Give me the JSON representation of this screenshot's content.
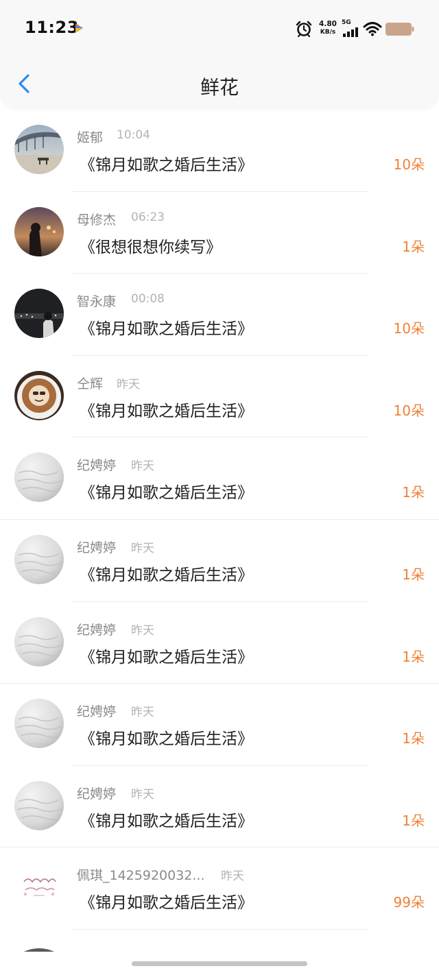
{
  "status_bar": {
    "time": "11:23",
    "net_speed_value": "4.80",
    "net_speed_unit": "KB/s",
    "network": "5G",
    "icons": [
      "app-badge-icon",
      "alarm-icon",
      "signal-icon",
      "wifi-icon",
      "battery-icon"
    ]
  },
  "nav": {
    "title": "鲜花",
    "back_icon": "chevron-left-icon"
  },
  "colors": {
    "accent_blue": "#2b8bf5",
    "count_orange": "#f08035",
    "muted_text": "#8a8a8a",
    "time_text": "#b3b3b3"
  },
  "items": [
    {
      "user": "姬郁",
      "time": "10:04",
      "book": "《锦月如歌之婚后生活》",
      "count": "10朵"
    },
    {
      "user": "母修杰",
      "time": "06:23",
      "book": "《很想很想你续写》",
      "count": "1朵"
    },
    {
      "user": "智永康",
      "time": "00:08",
      "book": "《锦月如歌之婚后生活》",
      "count": "10朵"
    },
    {
      "user": "仝辉",
      "time": "昨天",
      "book": "《锦月如歌之婚后生活》",
      "count": "10朵"
    },
    {
      "user": "纪娉婷",
      "time": "昨天",
      "book": "《锦月如歌之婚后生活》",
      "count": "1朵"
    },
    {
      "user": "纪娉婷",
      "time": "昨天",
      "book": "《锦月如歌之婚后生活》",
      "count": "1朵"
    },
    {
      "user": "纪娉婷",
      "time": "昨天",
      "book": "《锦月如歌之婚后生活》",
      "count": "1朵"
    },
    {
      "user": "纪娉婷",
      "time": "昨天",
      "book": "《锦月如歌之婚后生活》",
      "count": "1朵"
    },
    {
      "user": "纪娉婷",
      "time": "昨天",
      "book": "《锦月如歌之婚后生活》",
      "count": "1朵"
    },
    {
      "user": "佩琪_1425920032...",
      "time": "昨天",
      "book": "《锦月如歌之婚后生活》",
      "count": "99朵"
    }
  ]
}
